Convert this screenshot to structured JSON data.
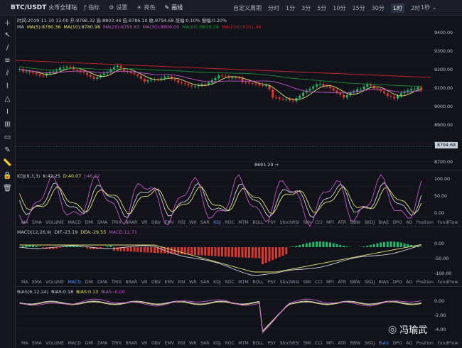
{
  "header": {
    "symbol": "BTC/USDT",
    "exchange": "火币全球站",
    "indicator": "指标",
    "settings": "设置",
    "theme": "亮色",
    "draw": "画线",
    "custom": "自定义周期",
    "periods": [
      "分时",
      "1分",
      "3分",
      "5分",
      "10分",
      "15分",
      "30分",
      "1时",
      "2时"
    ],
    "active_period": "1时",
    "right": "1秒"
  },
  "info": "时间:2019-11-10 13:00 开:8786.32 高:8803.46 低:8786.10 收:8794.68 涨幅:0.10% 振幅:0.20%",
  "ma": [
    "MA",
    "MA(5):8780.36",
    "MA(10):8780.98",
    "MA(20):8795.63",
    "MA(30):8806.00",
    "MA(60):8919.24",
    "MA(250):9161.46"
  ],
  "price_axis": [
    "9400.00",
    "9300.00",
    "9200.00",
    "9100.00",
    "9000.00",
    "8900.00",
    "8800.00",
    "8700.00"
  ],
  "current_price": "8794.68",
  "low_mark": "8691.29 →",
  "kdj": {
    "title": "KDJ(9,3,3)",
    "k": "K:42.25",
    "d": "D:40.07",
    "j": "J:46.62",
    "axis": [
      "100.00",
      "50.00",
      "0.00"
    ]
  },
  "macd": {
    "title": "MACD(12,26,9)",
    "dif": "DIF:-23.19",
    "dea": "DEA:-29.55",
    "macd": "MACD:12.71",
    "axis": [
      "0.00",
      "-50.00",
      "-100.00"
    ]
  },
  "bias": {
    "title": "BIAS(6,12,24)",
    "b1": "BIAS:0.18",
    "b2": "BIAS:0.13",
    "b3": "BIAS:-0.00",
    "axis": [
      "0.00",
      "-2.00",
      "-4.00"
    ]
  },
  "tabs": [
    "MA",
    "EMA",
    "VOLUME",
    "MACD",
    "DMI",
    "DMA",
    "TRIX",
    "BRAR",
    "VR",
    "OBV",
    "EMV",
    "RSI",
    "WR",
    "SAR",
    "KDJ",
    "ROC",
    "MTM",
    "BOLL",
    "PSY",
    "StochRSI",
    "SMI",
    "CCI",
    "MFI",
    "ATR",
    "BBW",
    "SKDJ",
    "BIAS",
    "DPO",
    "AO",
    "Position",
    "FundFlow"
  ],
  "tab_kdj": "KDJ",
  "tab_macd": "MACD",
  "tab_bias": "BIAS",
  "watermark": "冯瑜武",
  "colors": {
    "up": "#1fb86a",
    "down": "#d9382f",
    "yellow": "#e6e276",
    "pink": "#c058c8"
  }
}
